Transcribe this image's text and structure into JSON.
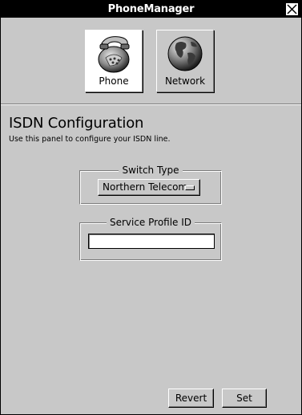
{
  "window": {
    "title": "PhoneManager"
  },
  "toolbar": {
    "phone_label": "Phone",
    "network_label": "Network"
  },
  "panel": {
    "title": "ISDN Configuration",
    "subtitle": "Use this panel to configure your ISDN line.",
    "switch_type": {
      "label": "Switch Type",
      "selected": "Northern Telecom"
    },
    "service_profile": {
      "label": "Service Profile ID",
      "value": ""
    }
  },
  "buttons": {
    "revert": "Revert",
    "set": "Set"
  },
  "icons": {
    "close": "close-icon",
    "phone": "phone-icon",
    "network": "globe-icon"
  }
}
